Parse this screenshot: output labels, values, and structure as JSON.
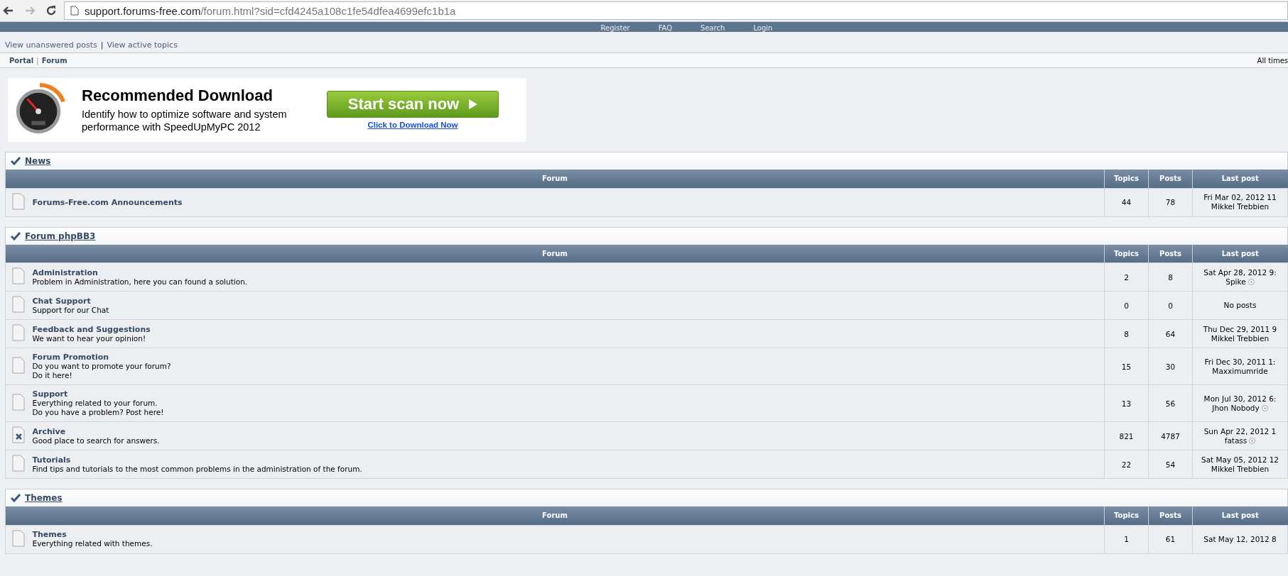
{
  "browser": {
    "url_host": "support.forums-free.com",
    "url_path": "/forum.html?sid=cfd4245a108c1fe54dfea4699efc1b1a"
  },
  "top_nav": [
    "Register",
    "FAQ",
    "Search",
    "Login"
  ],
  "quick_links": [
    "View unanswered posts",
    "View active topics"
  ],
  "quick_link_separator": "|",
  "breadcrumbs": [
    "Portal",
    "Forum"
  ],
  "breadcrumb_separator": "|",
  "timezone_note": "All times",
  "ad": {
    "title": "Recommended Download",
    "text": "Identify how to optimize software and system performance with SpeedUpMyPC 2012",
    "button": "Start scan now",
    "link": "Click to Download Now"
  },
  "categories": [
    {
      "title": "News",
      "columns": [
        "Forum",
        "Topics",
        "Posts",
        "Last post"
      ],
      "forums": [
        {
          "kind": "normal",
          "name": "Forums-Free.com Announcements",
          "topics": "44",
          "posts": "78",
          "last_post": {
            "date": "Fri Mar 02, 2012 11",
            "author": "Mikkel Trebbien",
            "latest_icon": false
          }
        }
      ]
    },
    {
      "title": "Forum phpBB3",
      "columns": [
        "Forum",
        "Topics",
        "Posts",
        "Last post"
      ],
      "forums": [
        {
          "kind": "normal",
          "name": "Administration",
          "description": [
            "Problem in Administration, here you can found a solution."
          ],
          "topics": "2",
          "posts": "8",
          "last_post": {
            "date": "Sat Apr 28, 2012 9:",
            "author": "Spike",
            "latest_icon": true
          }
        },
        {
          "kind": "normal",
          "name": "Chat Support",
          "description": [
            "Support for our Chat"
          ],
          "topics": "0",
          "posts": "0",
          "last_post": {
            "date": "No posts"
          }
        },
        {
          "kind": "normal",
          "name": "Feedback and Suggestions",
          "description": [
            "We want to hear your opinion!"
          ],
          "topics": "8",
          "posts": "64",
          "last_post": {
            "date": "Thu Dec 29, 2011 9",
            "author": "Mikkel Trebbien",
            "latest_icon": false
          }
        },
        {
          "kind": "normal",
          "name": "Forum Promotion",
          "description": [
            "Do you want to promote your forum?",
            "Do it here!"
          ],
          "topics": "15",
          "posts": "30",
          "last_post": {
            "date": "Fri Dec 30, 2011 1:",
            "author": "Maxximumride",
            "latest_icon": false
          }
        },
        {
          "kind": "normal",
          "name": "Support",
          "description": [
            "Everything related to your forum.",
            "Do you have a problem? Post here!"
          ],
          "topics": "13",
          "posts": "56",
          "last_post": {
            "date": "Mon Jul 30, 2012 6:",
            "author": "Jhon Nobody",
            "latest_icon": true
          }
        },
        {
          "kind": "locked",
          "name": "Archive",
          "description": [
            "Good place to search for answers."
          ],
          "topics": "821",
          "posts": "4787",
          "last_post": {
            "date": "Sun Apr 22, 2012 1",
            "author": "fatass",
            "latest_icon": true
          }
        },
        {
          "kind": "normal",
          "name": "Tutorials",
          "description": [
            "Find tips and tutorials to the most common problems in the administration of the forum."
          ],
          "topics": "22",
          "posts": "54",
          "last_post": {
            "date": "Sat May 05, 2012 12",
            "author": "Mikkel Trebbien",
            "latest_icon": false
          }
        }
      ]
    },
    {
      "title": "Themes",
      "columns": [
        "Forum",
        "Topics",
        "Posts",
        "Last post"
      ],
      "forums": [
        {
          "kind": "normal",
          "name": "Themes",
          "description": [
            "Everything related with themes."
          ],
          "topics": "1",
          "posts": "61",
          "last_post": {
            "date": "Sat May 12, 2012 8"
          }
        }
      ]
    }
  ]
}
